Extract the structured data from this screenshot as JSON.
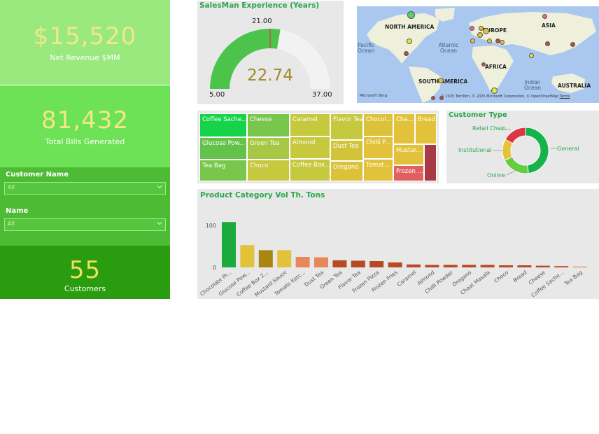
{
  "kpis": {
    "revenue": {
      "value": "$15,520",
      "label": "Net Revenue $MM"
    },
    "bills": {
      "value": "81,432",
      "label": "Total Bills Generated"
    },
    "customers": {
      "value": "55",
      "label": "Customers"
    }
  },
  "slicers": {
    "customer_name": {
      "label": "Customer Name",
      "value": "All"
    },
    "name": {
      "label": "Name",
      "value": "All"
    }
  },
  "gauge": {
    "title": "SalesMan Experience (Years)",
    "value": 22.74,
    "value_text": "22.74",
    "min": 5.0,
    "min_text": "5.00",
    "max": 37.0,
    "max_text": "37.00",
    "target": 21.0,
    "target_text": "21.00",
    "fill_color": "#4cc44c",
    "track_color": "#f2f2f2",
    "target_color": "#c0504d"
  },
  "map": {
    "continents": [
      "NORTH AMERICA",
      "EUROPE",
      "ASIA",
      "AFRICA",
      "SOUTH AMERICA",
      "AUSTRALIA"
    ],
    "oceans": {
      "pacific": "Pacific Ocean",
      "atlantic": "Atlantic Ocean",
      "indian": "Indian Ocean"
    },
    "attribution_brand": "Microsoft Bing",
    "attribution": "© 2025 TomTom, © 2025 Microsoft Corporation, © OpenStreetMap",
    "terms": "Terms"
  },
  "treemap": {
    "items": [
      {
        "label": "Coffee Sache...",
        "color": "#17d34a"
      },
      {
        "label": "Glucose Pow...",
        "color": "#62c24a"
      },
      {
        "label": "Tea Bag",
        "color": "#79c64d"
      },
      {
        "label": "Cheese",
        "color": "#79c64d"
      },
      {
        "label": "Green Tea",
        "color": "#a7c844"
      },
      {
        "label": "Choco",
        "color": "#c6c83e"
      },
      {
        "label": "Caramel",
        "color": "#c6c83e"
      },
      {
        "label": "Almond",
        "color": "#c6c83e"
      },
      {
        "label": "Coffee Box...",
        "color": "#c6c83e"
      },
      {
        "label": "Flavor Tea",
        "color": "#c6c83e"
      },
      {
        "label": "Dust Tea",
        "color": "#d2c43a"
      },
      {
        "label": "Oregano",
        "color": "#dcc23a"
      },
      {
        "label": "Chocol...",
        "color": "#dcc23a"
      },
      {
        "label": "Chilli P...",
        "color": "#e2c23a"
      },
      {
        "label": "Tomat...",
        "color": "#e2c23a"
      },
      {
        "label": "Cha...",
        "color": "#e2c23a"
      },
      {
        "label": "Bread",
        "color": "#e2c23a"
      },
      {
        "label": "Mustar...",
        "color": "#e2c23a"
      },
      {
        "label": "Frozen ...",
        "color": "#e06060"
      },
      {
        "label": "",
        "color": "#a83a44"
      }
    ]
  },
  "customer_type": {
    "title": "Customer Type",
    "segments": [
      {
        "name": "General",
        "value": 48,
        "color": "#16b34a"
      },
      {
        "name": "Online",
        "value": 20,
        "color": "#66cc44"
      },
      {
        "name": "Institutional",
        "value": 15,
        "color": "#e6c23a"
      },
      {
        "name": "Retail Chain",
        "value": 17,
        "color": "#dc3545"
      }
    ]
  },
  "chart_data": {
    "type": "bar",
    "title": "Product Category Vol Th. Tons",
    "categories": [
      "Chocolate Pr...",
      "Glucose Pow...",
      "Coffee Box 2...",
      "Mustard Sauce",
      "Tomato Ketc...",
      "Dust Tea",
      "Green Tea",
      "Flavor Tea",
      "Frozen Pizza",
      "Frozen Fries",
      "Caramel",
      "Almond",
      "Chilli Powder",
      "Oregano",
      "Chaat Masala",
      "Choco",
      "Bread",
      "Cheese",
      "Coffee Sache...",
      "Tea Bag"
    ],
    "values": [
      108,
      53,
      41,
      41,
      25,
      24,
      17,
      16,
      15,
      12,
      7,
      6,
      6,
      6,
      6,
      5,
      5,
      4,
      3,
      2
    ],
    "colors": [
      "#1aab3c",
      "#e2c23a",
      "#a8860f",
      "#e2c23a",
      "#e8885a",
      "#e8885a",
      "#b84a22",
      "#b84a22",
      "#b84a22",
      "#b84a22",
      "#b84a22",
      "#b84a22",
      "#b84a22",
      "#b84a22",
      "#b84a22",
      "#b84a22",
      "#b84a22",
      "#b84a22",
      "#b84a22",
      "#e8885a"
    ],
    "yticks": [
      0,
      100
    ],
    "ylim": [
      0,
      110
    ]
  }
}
